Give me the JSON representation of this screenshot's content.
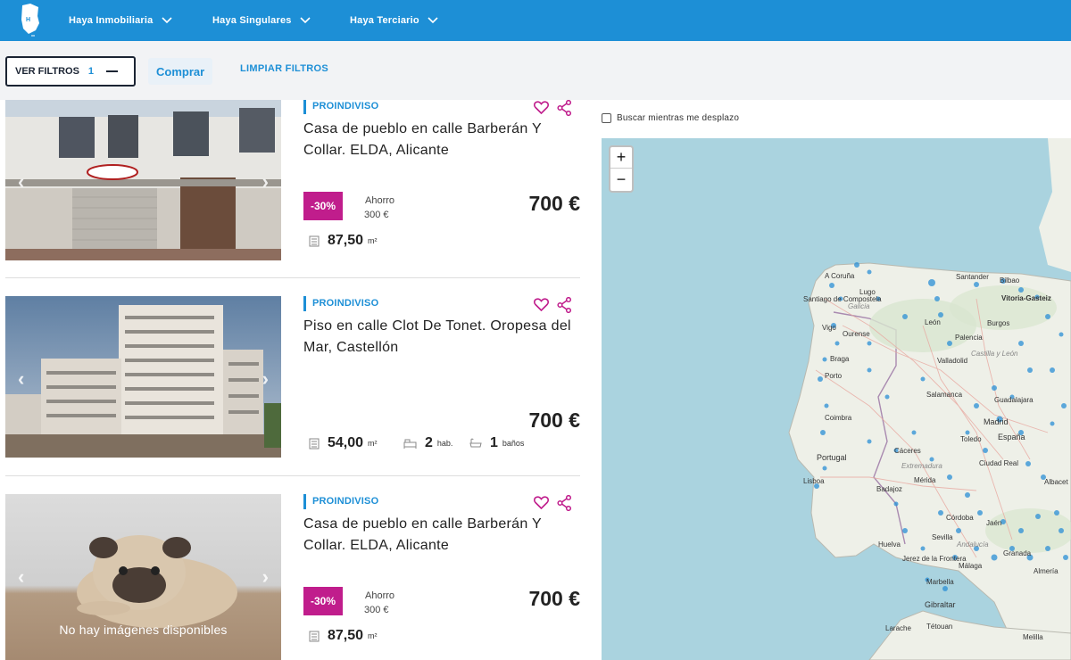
{
  "nav": {
    "items": [
      {
        "label": "Haya Inmobiliaria"
      },
      {
        "label": "Haya Singulares"
      },
      {
        "label": "Haya Terciario"
      }
    ]
  },
  "filters": {
    "ver_filtros_label": "VER FILTROS",
    "ver_filtros_count": "1",
    "comprar_label": "Comprar",
    "limpiar_label": "LIMPIAR FILTROS"
  },
  "listings": [
    {
      "tag": "PROINDIVISO",
      "title": "Casa de pueblo en calle Barberán Y Collar. ELDA, Alicante",
      "discount": "-30%",
      "ahorro_label": "Ahorro",
      "ahorro_value": "300 €",
      "price": "700 €",
      "area": "87,50",
      "area_unit": "m²"
    },
    {
      "tag": "PROINDIVISO",
      "title": "Piso en calle Clot De Tonet. Oropesa del Mar, Castellón",
      "price": "700 €",
      "area": "54,00",
      "area_unit": "m²",
      "rooms": "2",
      "rooms_unit": "hab.",
      "baths": "1",
      "baths_unit": "baños"
    },
    {
      "tag": "PROINDIVISO",
      "title": "Casa de pueblo en calle Barberán Y Collar. ELDA, Alicante",
      "discount": "-30%",
      "ahorro_label": "Ahorro",
      "ahorro_value": "300 €",
      "price": "700 €",
      "area": "87,50",
      "area_unit": "m²",
      "no_image_text": "No hay imágenes disponibles"
    }
  ],
  "map": {
    "search_while_moving": "Buscar mientras me desplazo",
    "zoom_in": "+",
    "zoom_out": "−",
    "labels": {
      "coruna": "A Coruña",
      "lugo": "Lugo",
      "santiago": "Santiago de Compostela",
      "galicia": "Galicia",
      "vigo": "Vigo",
      "ourense": "Ourense",
      "braga": "Braga",
      "porto": "Porto",
      "coimbra": "Coimbra",
      "portugal": "Portugal",
      "lisboa": "Lisboa",
      "santander": "Santander",
      "bilbao": "Bilbao",
      "vitoria": "Vitoria-Gasteiz",
      "leon": "León",
      "burgos": "Burgos",
      "palencia": "Palencia",
      "valladolid": "Valladolid",
      "castilla": "Castilla y León",
      "salamanca": "Salamanca",
      "guadalajara": "Guadalajara",
      "madrid": "Madrid",
      "toledo": "Toledo",
      "espana": "España",
      "caceres": "Cáceres",
      "extremadura": "Extremadura",
      "merida": "Mérida",
      "badajoz": "Badajoz",
      "ciudad_real": "Ciudad Real",
      "cordoba": "Córdoba",
      "jaen": "Jaén",
      "sevilla": "Sevilla",
      "andalucia": "Andalucía",
      "granada": "Granada",
      "huelva": "Huelva",
      "jerez": "Jerez de la Frontera",
      "malaga": "Málaga",
      "almeria": "Almería",
      "marbella": "Marbella",
      "gibraltar": "Gibraltar",
      "larache": "Larache",
      "tetouan": "Tétouan",
      "melilla": "Melilla",
      "albacete": "Albacet"
    }
  },
  "colors": {
    "brand_blue": "#1d8fd6",
    "discount_magenta": "#c01d8c",
    "fav_magenta": "#c01d8c",
    "map_sea": "#aad3df",
    "map_land": "#eef0e8",
    "marker": "#2b8fd6"
  },
  "icons": [
    "haya-logo-icon",
    "chevron-down-icon",
    "heart-icon",
    "share-icon",
    "area-icon",
    "bed-icon",
    "bath-icon",
    "arrow-left-icon",
    "arrow-right-icon"
  ]
}
